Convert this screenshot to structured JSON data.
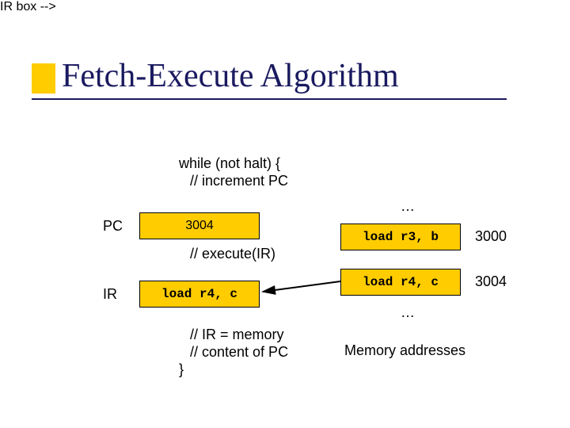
{
  "title": "Fetch-Execute Algorithm",
  "code": {
    "line1": "while (not halt) {",
    "line2": "// increment PC",
    "line3": "// execute(IR)",
    "line4": "// IR = memory",
    "line5": "//   content of PC",
    "line6": "}"
  },
  "labels": {
    "pc": "PC",
    "ir": "IR",
    "pc_value": "3004",
    "ir_value": "load r4, c",
    "mem_top_ellipsis": "…",
    "mem_bot_ellipsis": "…",
    "mem_row1": "load r3, b",
    "mem_row2": "load r4, c",
    "addr1": "3000",
    "addr2": "3004",
    "mem_caption": "Memory addresses"
  }
}
